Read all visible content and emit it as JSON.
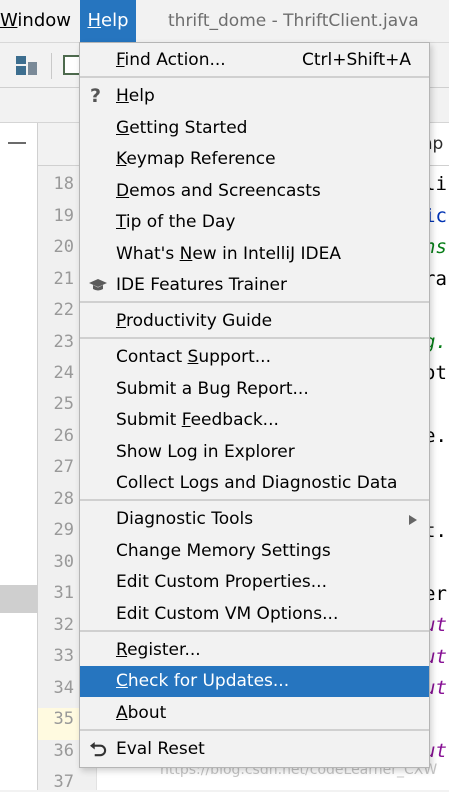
{
  "menubar": {
    "window_label": "Window",
    "window_u": "W",
    "window_rest": "indow",
    "help_u": "H",
    "help_rest": "elp",
    "title": "thrift_dome - ThriftClient.java"
  },
  "editor": {
    "line_numbers": [
      "18",
      "19",
      "20",
      "21",
      "22",
      "23",
      "24",
      "25",
      "26",
      "27",
      "28",
      "29",
      "30",
      "31",
      "32",
      "33",
      "34",
      "35",
      "36",
      "37"
    ],
    "visible_code_fragments": [
      {
        "text": "li",
        "color": "#000000"
      },
      {
        "text": "ic",
        "color": "#0033b3"
      },
      {
        "text": "ns",
        "color": "#067d17"
      },
      {
        "text": "ra",
        "color": "#000000"
      },
      {
        "text": "g.",
        "color": "#067d17"
      },
      {
        "text": "ot",
        "color": "#000000"
      },
      {
        "text": "e.",
        "color": "#000000"
      },
      {
        "text": "t.",
        "color": "#000000"
      },
      {
        "text": "er",
        "color": "#000000"
      },
      {
        "text": "ut",
        "color": "#871094"
      },
      {
        "text": "ut",
        "color": "#871094"
      },
      {
        "text": "ut",
        "color": "#871094"
      },
      {
        "text": "ut",
        "color": "#871094"
      }
    ],
    "tab_fragment": "mp",
    "watermark": "https://blog.csdn.net/codeLearner_CXW"
  },
  "help_menu": {
    "items": [
      {
        "u": "F",
        "rest": "ind Action...",
        "shortcut": "Ctrl+Shift+A",
        "icon": ""
      },
      {
        "u": "H",
        "rest": "elp",
        "shortcut": "",
        "icon": "question-icon"
      },
      {
        "pre": "",
        "u": "G",
        "rest": "etting Started",
        "icon": ""
      },
      {
        "pre": "",
        "u": "K",
        "rest": "eymap Reference",
        "icon": ""
      },
      {
        "pre": "",
        "u": "D",
        "rest": "emos and Screencasts",
        "icon": ""
      },
      {
        "pre": "",
        "u": "T",
        "rest": "ip of the Day",
        "icon": ""
      },
      {
        "pre": "What's ",
        "u": "N",
        "rest": "ew in IntelliJ IDEA",
        "icon": ""
      },
      {
        "pre": "IDE Features Trainer",
        "u": "",
        "rest": "",
        "icon": "graduation-cap-icon"
      },
      {
        "pre": "",
        "u": "P",
        "rest": "roductivity Guide",
        "icon": ""
      },
      {
        "pre": "Contact ",
        "u": "S",
        "rest": "upport...",
        "icon": ""
      },
      {
        "pre": "Submit a Bug Report...",
        "u": "",
        "rest": "",
        "icon": ""
      },
      {
        "pre": "Submit ",
        "u": "F",
        "rest": "eedback...",
        "icon": ""
      },
      {
        "pre": "Show Log in Explorer",
        "u": "",
        "rest": "",
        "icon": ""
      },
      {
        "pre": "Collect Logs and Diagnostic Data",
        "u": "",
        "rest": "",
        "icon": ""
      },
      {
        "pre": "Diagnostic Tools",
        "u": "",
        "rest": "",
        "icon": "submenu-arrow-icon"
      },
      {
        "pre": "Change Memory Settings",
        "u": "",
        "rest": "",
        "icon": ""
      },
      {
        "pre": "Edit Custom Properties...",
        "u": "",
        "rest": "",
        "icon": ""
      },
      {
        "pre": "Edit Custom VM Options...",
        "u": "",
        "rest": "",
        "icon": ""
      },
      {
        "pre": "",
        "u": "R",
        "rest": "egister...",
        "icon": ""
      },
      {
        "pre": "",
        "u": "C",
        "rest": "heck for Updates...",
        "icon": "",
        "selected": true
      },
      {
        "pre": "",
        "u": "A",
        "rest": "bout",
        "icon": ""
      },
      {
        "pre": "Eval Reset",
        "u": "",
        "rest": "",
        "icon": "reset-arrow-icon"
      }
    ]
  },
  "colors": {
    "selection": "#2675bf",
    "menu_bg": "#f2f2f2",
    "current_line": "#fffae0"
  }
}
